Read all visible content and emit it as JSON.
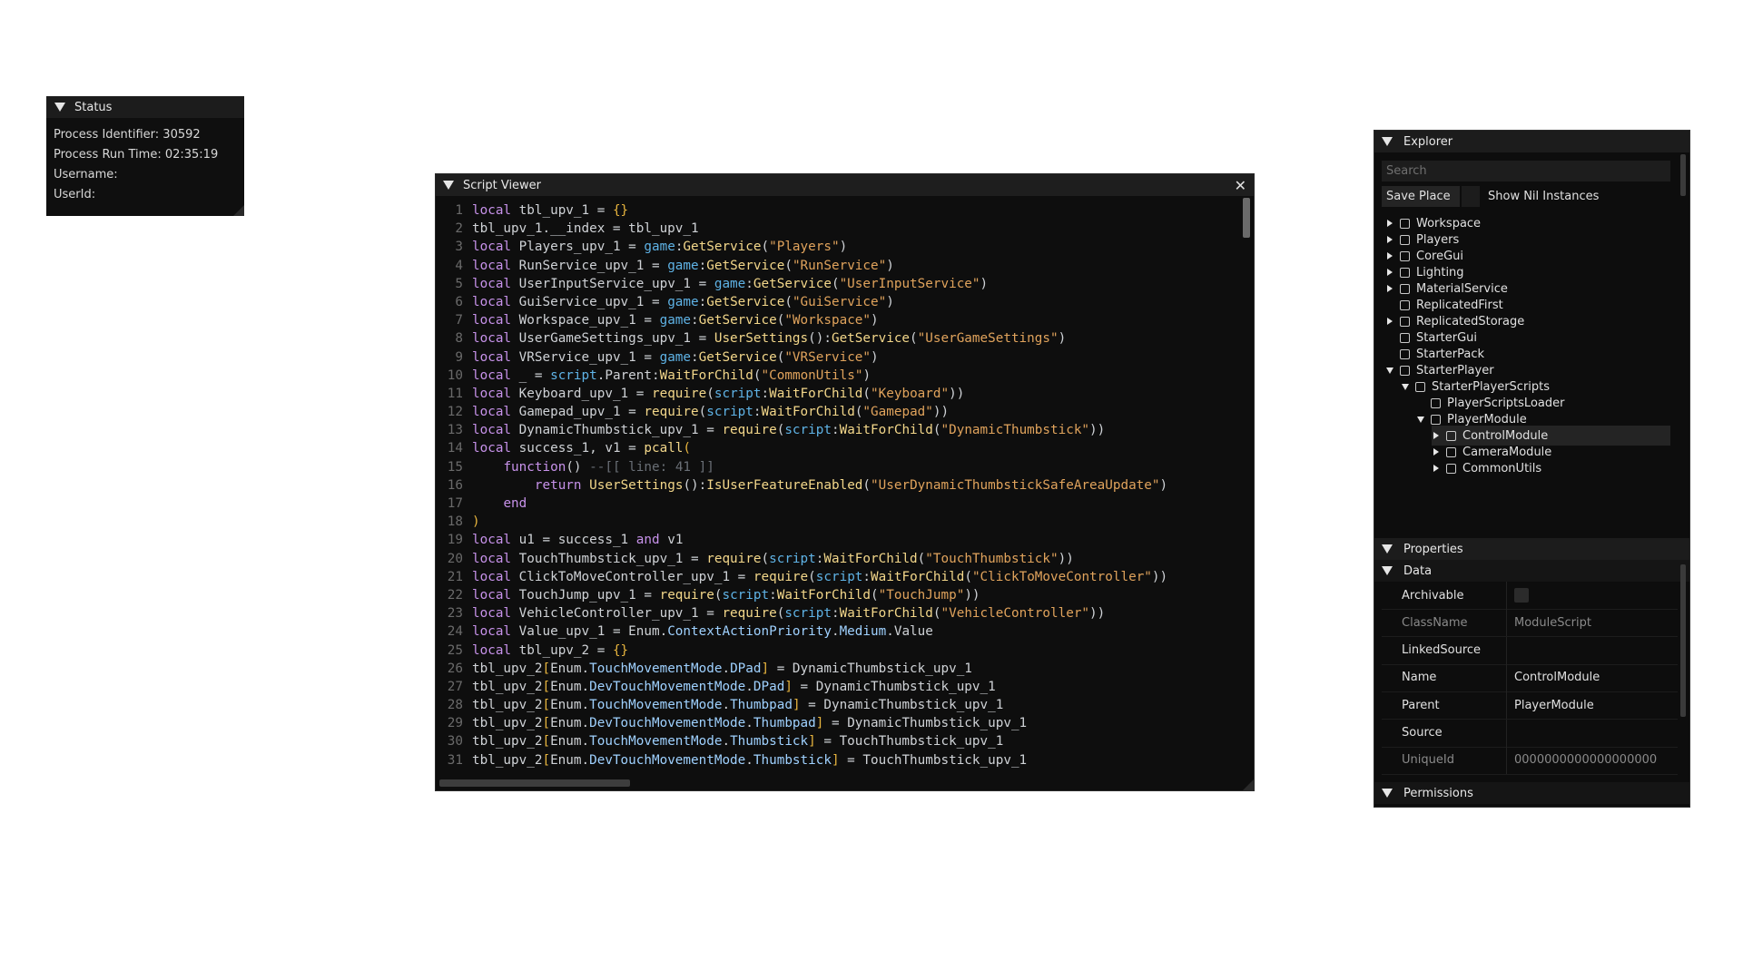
{
  "status": {
    "title": "Status",
    "process_identifier": "Process Identifier: 30592",
    "process_run_time": "Process Run Time: 02:35:19",
    "username": "Username:",
    "userid": "UserId:"
  },
  "script_viewer": {
    "title": "Script Viewer",
    "close": "✕",
    "lines": [
      [
        [
          "kw",
          "local"
        ],
        [
          "src",
          " tbl_upv_1 = "
        ],
        [
          "br",
          "{}"
        ]
      ],
      [
        [
          "src",
          "tbl_upv_1.__index = tbl_upv_1"
        ]
      ],
      [
        [
          "kw",
          "local"
        ],
        [
          "src",
          " Players_upv_1 = "
        ],
        [
          "gb",
          "game"
        ],
        [
          "src",
          ":"
        ],
        [
          "fn",
          "GetService"
        ],
        [
          "src",
          "("
        ],
        [
          "st",
          "\"Players\""
        ],
        [
          "src",
          ")"
        ]
      ],
      [
        [
          "kw",
          "local"
        ],
        [
          "src",
          " RunService_upv_1 = "
        ],
        [
          "gb",
          "game"
        ],
        [
          "src",
          ":"
        ],
        [
          "fn",
          "GetService"
        ],
        [
          "src",
          "("
        ],
        [
          "st",
          "\"RunService\""
        ],
        [
          "src",
          ")"
        ]
      ],
      [
        [
          "kw",
          "local"
        ],
        [
          "src",
          " UserInputService_upv_1 = "
        ],
        [
          "gb",
          "game"
        ],
        [
          "src",
          ":"
        ],
        [
          "fn",
          "GetService"
        ],
        [
          "src",
          "("
        ],
        [
          "st",
          "\"UserInputService\""
        ],
        [
          "src",
          ")"
        ]
      ],
      [
        [
          "kw",
          "local"
        ],
        [
          "src",
          " GuiService_upv_1 = "
        ],
        [
          "gb",
          "game"
        ],
        [
          "src",
          ":"
        ],
        [
          "fn",
          "GetService"
        ],
        [
          "src",
          "("
        ],
        [
          "st",
          "\"GuiService\""
        ],
        [
          "src",
          ")"
        ]
      ],
      [
        [
          "kw",
          "local"
        ],
        [
          "src",
          " Workspace_upv_1 = "
        ],
        [
          "gb",
          "game"
        ],
        [
          "src",
          ":"
        ],
        [
          "fn",
          "GetService"
        ],
        [
          "src",
          "("
        ],
        [
          "st",
          "\"Workspace\""
        ],
        [
          "src",
          ")"
        ]
      ],
      [
        [
          "kw",
          "local"
        ],
        [
          "src",
          " UserGameSettings_upv_1 = "
        ],
        [
          "fn",
          "UserSettings"
        ],
        [
          "src",
          "():"
        ],
        [
          "fn",
          "GetService"
        ],
        [
          "src",
          "("
        ],
        [
          "st",
          "\"UserGameSettings\""
        ],
        [
          "src",
          ")"
        ]
      ],
      [
        [
          "kw",
          "local"
        ],
        [
          "src",
          " VRService_upv_1 = "
        ],
        [
          "gb",
          "game"
        ],
        [
          "src",
          ":"
        ],
        [
          "fn",
          "GetService"
        ],
        [
          "src",
          "("
        ],
        [
          "st",
          "\"VRService\""
        ],
        [
          "src",
          ")"
        ]
      ],
      [
        [
          "kw",
          "local"
        ],
        [
          "src",
          " _ = "
        ],
        [
          "gb",
          "script"
        ],
        [
          "src",
          ".Parent:"
        ],
        [
          "fn",
          "WaitForChild"
        ],
        [
          "src",
          "("
        ],
        [
          "st",
          "\"CommonUtils\""
        ],
        [
          "src",
          ")"
        ]
      ],
      [
        [
          "kw",
          "local"
        ],
        [
          "src",
          " Keyboard_upv_1 = "
        ],
        [
          "fn",
          "require"
        ],
        [
          "src",
          "("
        ],
        [
          "gb",
          "script"
        ],
        [
          "src",
          ":"
        ],
        [
          "fn",
          "WaitForChild"
        ],
        [
          "src",
          "("
        ],
        [
          "st",
          "\"Keyboard\""
        ],
        [
          "src",
          "))"
        ]
      ],
      [
        [
          "kw",
          "local"
        ],
        [
          "src",
          " Gamepad_upv_1 = "
        ],
        [
          "fn",
          "require"
        ],
        [
          "src",
          "("
        ],
        [
          "gb",
          "script"
        ],
        [
          "src",
          ":"
        ],
        [
          "fn",
          "WaitForChild"
        ],
        [
          "src",
          "("
        ],
        [
          "st",
          "\"Gamepad\""
        ],
        [
          "src",
          "))"
        ]
      ],
      [
        [
          "kw",
          "local"
        ],
        [
          "src",
          " DynamicThumbstick_upv_1 = "
        ],
        [
          "fn",
          "require"
        ],
        [
          "src",
          "("
        ],
        [
          "gb",
          "script"
        ],
        [
          "src",
          ":"
        ],
        [
          "fn",
          "WaitForChild"
        ],
        [
          "src",
          "("
        ],
        [
          "st",
          "\"DynamicThumbstick\""
        ],
        [
          "src",
          "))"
        ]
      ],
      [
        [
          "kw",
          "local"
        ],
        [
          "src",
          " success_1, v1 = "
        ],
        [
          "fn",
          "pcall"
        ],
        [
          "br",
          "("
        ]
      ],
      [
        [
          "src",
          "    "
        ],
        [
          "kw",
          "function"
        ],
        [
          "src",
          "() "
        ],
        [
          "cm",
          "--[[ line: 41 ]]"
        ]
      ],
      [
        [
          "src",
          "        "
        ],
        [
          "kw",
          "return"
        ],
        [
          "src",
          " "
        ],
        [
          "fn",
          "UserSettings"
        ],
        [
          "src",
          "():"
        ],
        [
          "fn",
          "IsUserFeatureEnabled"
        ],
        [
          "src",
          "("
        ],
        [
          "st",
          "\"UserDynamicThumbstickSafeAreaUpdate\""
        ],
        [
          "src",
          ")"
        ]
      ],
      [
        [
          "src",
          "    "
        ],
        [
          "kw",
          "end"
        ]
      ],
      [
        [
          "br",
          ")"
        ]
      ],
      [
        [
          "kw",
          "local"
        ],
        [
          "src",
          " u1 = success_1 "
        ],
        [
          "kw",
          "and"
        ],
        [
          "src",
          " v1"
        ]
      ],
      [
        [
          "kw",
          "local"
        ],
        [
          "src",
          " TouchThumbstick_upv_1 = "
        ],
        [
          "fn",
          "require"
        ],
        [
          "src",
          "("
        ],
        [
          "gb",
          "script"
        ],
        [
          "src",
          ":"
        ],
        [
          "fn",
          "WaitForChild"
        ],
        [
          "src",
          "("
        ],
        [
          "st",
          "\"TouchThumbstick\""
        ],
        [
          "src",
          "))"
        ]
      ],
      [
        [
          "kw",
          "local"
        ],
        [
          "src",
          " ClickToMoveController_upv_1 = "
        ],
        [
          "fn",
          "require"
        ],
        [
          "src",
          "("
        ],
        [
          "gb",
          "script"
        ],
        [
          "src",
          ":"
        ],
        [
          "fn",
          "WaitForChild"
        ],
        [
          "src",
          "("
        ],
        [
          "st",
          "\"ClickToMoveController\""
        ],
        [
          "src",
          "))"
        ]
      ],
      [
        [
          "kw",
          "local"
        ],
        [
          "src",
          " TouchJump_upv_1 = "
        ],
        [
          "fn",
          "require"
        ],
        [
          "src",
          "("
        ],
        [
          "gb",
          "script"
        ],
        [
          "src",
          ":"
        ],
        [
          "fn",
          "WaitForChild"
        ],
        [
          "src",
          "("
        ],
        [
          "st",
          "\"TouchJump\""
        ],
        [
          "src",
          "))"
        ]
      ],
      [
        [
          "kw",
          "local"
        ],
        [
          "src",
          " VehicleController_upv_1 = "
        ],
        [
          "fn",
          "require"
        ],
        [
          "src",
          "("
        ],
        [
          "gb",
          "script"
        ],
        [
          "src",
          ":"
        ],
        [
          "fn",
          "WaitForChild"
        ],
        [
          "src",
          "("
        ],
        [
          "st",
          "\"VehicleController\""
        ],
        [
          "src",
          "))"
        ]
      ],
      [
        [
          "kw",
          "local"
        ],
        [
          "src",
          " Value_upv_1 = Enum."
        ],
        [
          "pr",
          "ContextActionPriority"
        ],
        [
          "src",
          "."
        ],
        [
          "pr",
          "Medium"
        ],
        [
          "src",
          ".Value"
        ]
      ],
      [
        [
          "kw",
          "local"
        ],
        [
          "src",
          " tbl_upv_2 = "
        ],
        [
          "br",
          "{}"
        ]
      ],
      [
        [
          "src",
          "tbl_upv_2"
        ],
        [
          "br",
          "["
        ],
        [
          "src",
          "Enum."
        ],
        [
          "pr",
          "TouchMovementMode"
        ],
        [
          "src",
          "."
        ],
        [
          "pr",
          "DPad"
        ],
        [
          "br",
          "]"
        ],
        [
          "src",
          " = DynamicThumbstick_upv_1"
        ]
      ],
      [
        [
          "src",
          "tbl_upv_2"
        ],
        [
          "br",
          "["
        ],
        [
          "src",
          "Enum."
        ],
        [
          "pr",
          "DevTouchMovementMode"
        ],
        [
          "src",
          "."
        ],
        [
          "pr",
          "DPad"
        ],
        [
          "br",
          "]"
        ],
        [
          "src",
          " = DynamicThumbstick_upv_1"
        ]
      ],
      [
        [
          "src",
          "tbl_upv_2"
        ],
        [
          "br",
          "["
        ],
        [
          "src",
          "Enum."
        ],
        [
          "pr",
          "TouchMovementMode"
        ],
        [
          "src",
          "."
        ],
        [
          "pr",
          "Thumbpad"
        ],
        [
          "br",
          "]"
        ],
        [
          "src",
          " = DynamicThumbstick_upv_1"
        ]
      ],
      [
        [
          "src",
          "tbl_upv_2"
        ],
        [
          "br",
          "["
        ],
        [
          "src",
          "Enum."
        ],
        [
          "pr",
          "DevTouchMovementMode"
        ],
        [
          "src",
          "."
        ],
        [
          "pr",
          "Thumbpad"
        ],
        [
          "br",
          "]"
        ],
        [
          "src",
          " = DynamicThumbstick_upv_1"
        ]
      ],
      [
        [
          "src",
          "tbl_upv_2"
        ],
        [
          "br",
          "["
        ],
        [
          "src",
          "Enum."
        ],
        [
          "pr",
          "TouchMovementMode"
        ],
        [
          "src",
          "."
        ],
        [
          "pr",
          "Thumbstick"
        ],
        [
          "br",
          "]"
        ],
        [
          "src",
          " = TouchThumbstick_upv_1"
        ]
      ],
      [
        [
          "src",
          "tbl_upv_2"
        ],
        [
          "br",
          "["
        ],
        [
          "src",
          "Enum."
        ],
        [
          "pr",
          "DevTouchMovementMode"
        ],
        [
          "src",
          "."
        ],
        [
          "pr",
          "Thumbstick"
        ],
        [
          "br",
          "]"
        ],
        [
          "src",
          " = TouchThumbstick_upv_1"
        ]
      ]
    ]
  },
  "explorer": {
    "title": "Explorer",
    "search_placeholder": "Search",
    "save_place": "Save Place",
    "show_nil": "Show Nil Instances",
    "tree": [
      {
        "label": "Workspace",
        "icon": "globe-icon",
        "depth": 0,
        "arrow": "right"
      },
      {
        "label": "Players",
        "icon": "players-icon",
        "depth": 0,
        "arrow": "right"
      },
      {
        "label": "CoreGui",
        "icon": "coregui-icon",
        "depth": 0,
        "arrow": "right"
      },
      {
        "label": "Lighting",
        "icon": "lighting-icon",
        "depth": 0,
        "arrow": "right"
      },
      {
        "label": "MaterialService",
        "icon": "material-icon",
        "depth": 0,
        "arrow": "right"
      },
      {
        "label": "ReplicatedFirst",
        "icon": "replicated-first-icon",
        "depth": 0,
        "arrow": ""
      },
      {
        "label": "ReplicatedStorage",
        "icon": "storage-icon",
        "depth": 0,
        "arrow": "right"
      },
      {
        "label": "StarterGui",
        "icon": "startergui-icon",
        "depth": 0,
        "arrow": ""
      },
      {
        "label": "StarterPack",
        "icon": "starterpack-icon",
        "depth": 0,
        "arrow": ""
      },
      {
        "label": "StarterPlayer",
        "icon": "starterplayer-icon",
        "depth": 0,
        "arrow": "down"
      },
      {
        "label": "StarterPlayerScripts",
        "icon": "scripts-folder-icon",
        "depth": 1,
        "arrow": "down"
      },
      {
        "label": "PlayerScriptsLoader",
        "icon": "script-icon",
        "depth": 2,
        "arrow": ""
      },
      {
        "label": "PlayerModule",
        "icon": "module-script-icon",
        "depth": 2,
        "arrow": "down"
      },
      {
        "label": "ControlModule",
        "icon": "module-script-icon",
        "depth": 3,
        "arrow": "right",
        "selected": true
      },
      {
        "label": "CameraModule",
        "icon": "module-script-icon",
        "depth": 3,
        "arrow": "right"
      },
      {
        "label": "CommonUtils",
        "icon": "module-script-icon",
        "depth": 3,
        "arrow": "right"
      }
    ]
  },
  "properties": {
    "title": "Properties",
    "data_section": "Data",
    "permissions_section": "Permissions",
    "rows": [
      {
        "key": "Archivable",
        "value": "",
        "type": "checkbox"
      },
      {
        "key": "ClassName",
        "value": "ModuleScript",
        "dim": true
      },
      {
        "key": "LinkedSource",
        "value": ""
      },
      {
        "key": "Name",
        "value": "ControlModule"
      },
      {
        "key": "Parent",
        "value": "PlayerModule"
      },
      {
        "key": "Source",
        "value": ""
      },
      {
        "key": "UniqueId",
        "value": "0000000000000000000",
        "dim": true
      }
    ]
  }
}
